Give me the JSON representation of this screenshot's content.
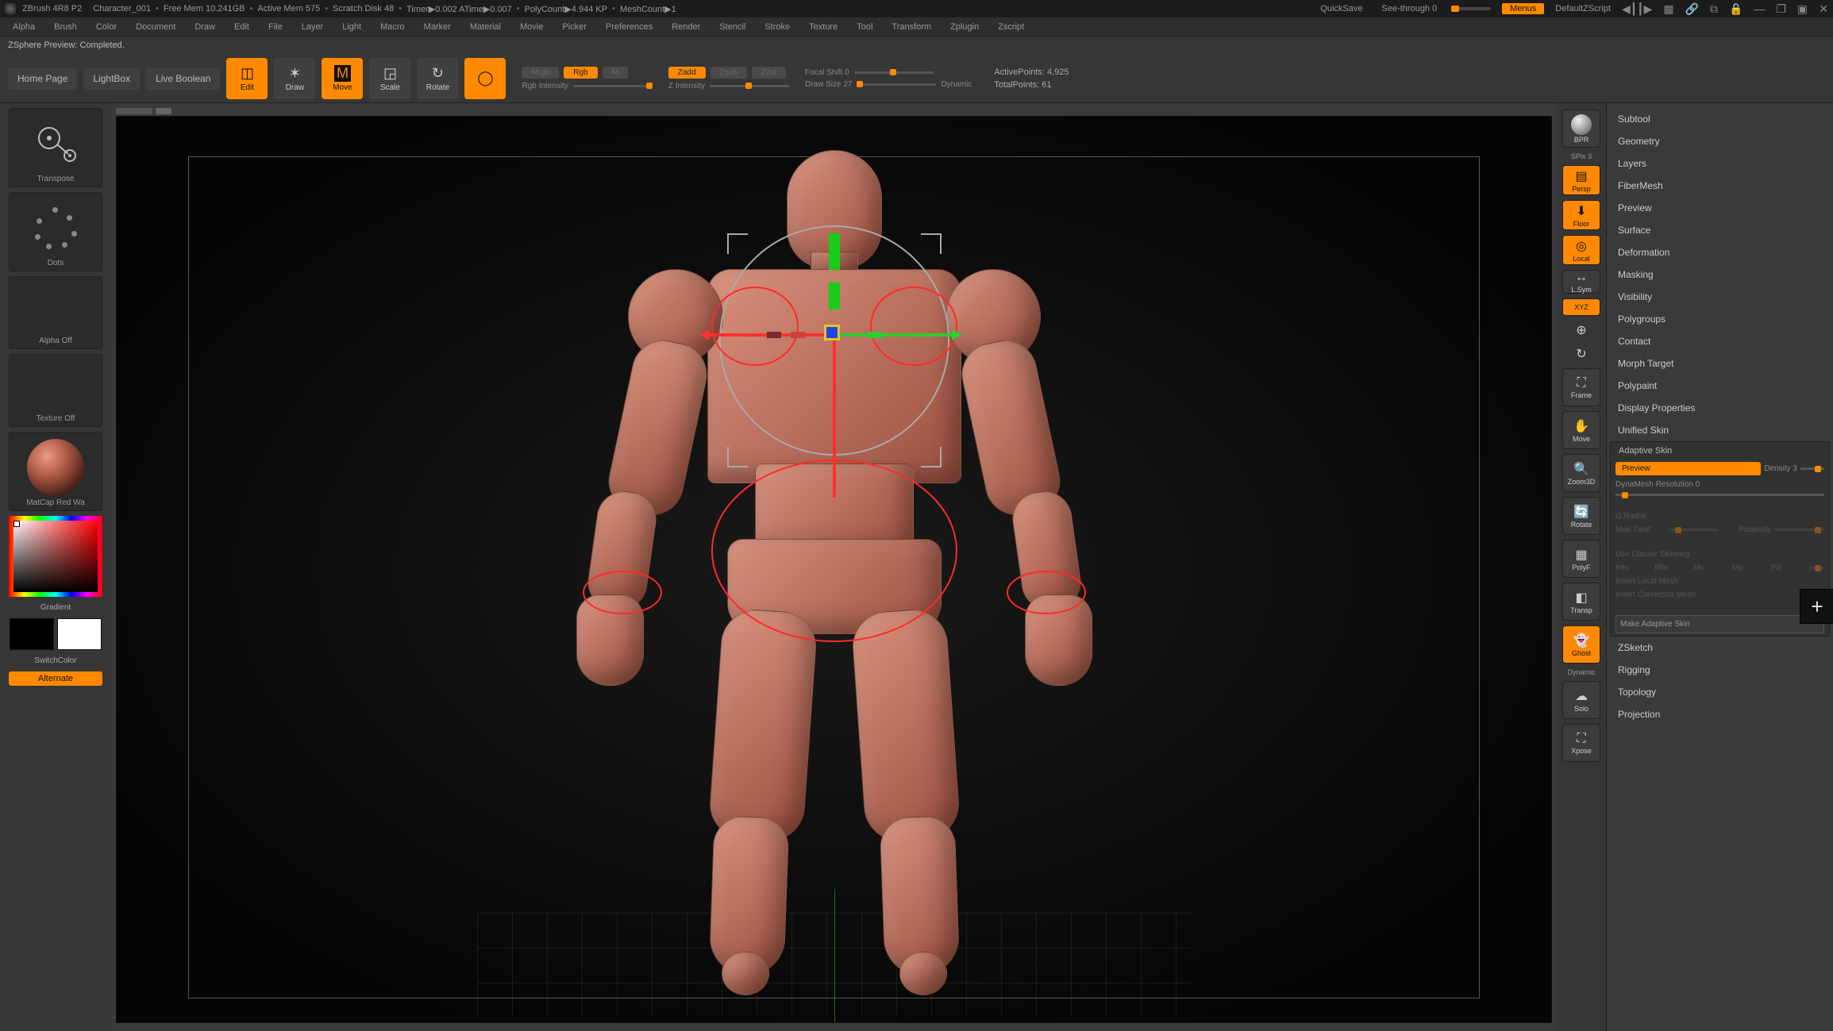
{
  "title_bar": {
    "app": "ZBrush 4R8 P2",
    "doc": "Character_001",
    "free_mem": "Free Mem 10.241GB",
    "active_mem": "Active Mem 575",
    "scratch": "Scratch Disk 48",
    "timer": "Timer▶0.002 ATime▶0.007",
    "poly": "PolyCount▶4.944 KP",
    "mesh": "MeshCount▶1",
    "quicksave": "QuickSave",
    "seethrough": "See-through  0",
    "menus": "Menus",
    "zscript": "DefaultZScript"
  },
  "menu": [
    "Alpha",
    "Brush",
    "Color",
    "Document",
    "Draw",
    "Edit",
    "File",
    "Layer",
    "Light",
    "Macro",
    "Marker",
    "Material",
    "Movie",
    "Picker",
    "Preferences",
    "Render",
    "Stencil",
    "Stroke",
    "Texture",
    "Tool",
    "Transform",
    "Zplugin",
    "Zscript"
  ],
  "status": "ZSphere Preview: Completed.",
  "toolbar": {
    "home": "Home Page",
    "lightbox": "LightBox",
    "livebool": "Live Boolean",
    "modes": {
      "edit": "Edit",
      "draw": "Draw",
      "move": "Move",
      "scale": "Scale",
      "rotate": "Rotate",
      "gizmo": ""
    },
    "mrgb": "Mrgb",
    "rgb": "Rgb",
    "m": "M",
    "rgb_int": "Rgb Intensity",
    "zadd": "Zadd",
    "zsub": "Zsub",
    "zcut": "Zcut",
    "z_int": "Z Intensity",
    "focal": "Focal Shift 0",
    "drawsize": "Draw Size 27",
    "dynamic": "Dynamic",
    "active_pts": "ActivePoints: 4,925",
    "total_pts": "TotalPoints: 61"
  },
  "left": {
    "transpose": "Transpose",
    "dots": "Dots",
    "alpha": "Alpha Off",
    "texture": "Texture Off",
    "material": "MatCap Red Wa",
    "gradient": "Gradient",
    "switch": "SwitchColor",
    "alternate": "Alternate"
  },
  "vtools": {
    "bpr": "BPR",
    "spix": "SPix 3",
    "persp": "Persp",
    "floor": "Floor",
    "local": "Local",
    "lsym": "L.Sym",
    "xyz": "XYZ",
    "frame": "Frame",
    "move": "Move",
    "zoom": "Zoom3D",
    "rotate": "Rotate",
    "polyf": "PolyF",
    "transp": "Transp",
    "ghost": "Ghost",
    "solo": "Solo",
    "xpose": "Xpose",
    "dynamic": "Dynamic"
  },
  "panel": {
    "items": [
      "Subtool",
      "Geometry",
      "Layers",
      "FiberMesh",
      "Preview",
      "Surface",
      "Deformation",
      "Masking",
      "Visibility",
      "Polygroups",
      "Contact",
      "Morph Target",
      "Polypaint",
      "Display Properties",
      "Unified Skin"
    ],
    "adaptive": {
      "title": "Adaptive Skin",
      "preview": "Preview",
      "density": "Density 3",
      "dyna": "DynaMesh Resolution 0",
      "gradial": "G Radial",
      "maxtwist": "Max Twist",
      "proximity": "Proximity",
      "classic": "Use Classic Skinning",
      "ires": "Ires",
      "mbr": "Mbr",
      "mc": "Mc",
      "mp": "Mp",
      "pd": "Pd",
      "ilm": "Insert Local Mesh",
      "icm": "Insert Connector Mesh",
      "make": "Make Adaptive Skin"
    },
    "tail": [
      "ZSketch",
      "Rigging",
      "Topology",
      "Projection"
    ]
  }
}
